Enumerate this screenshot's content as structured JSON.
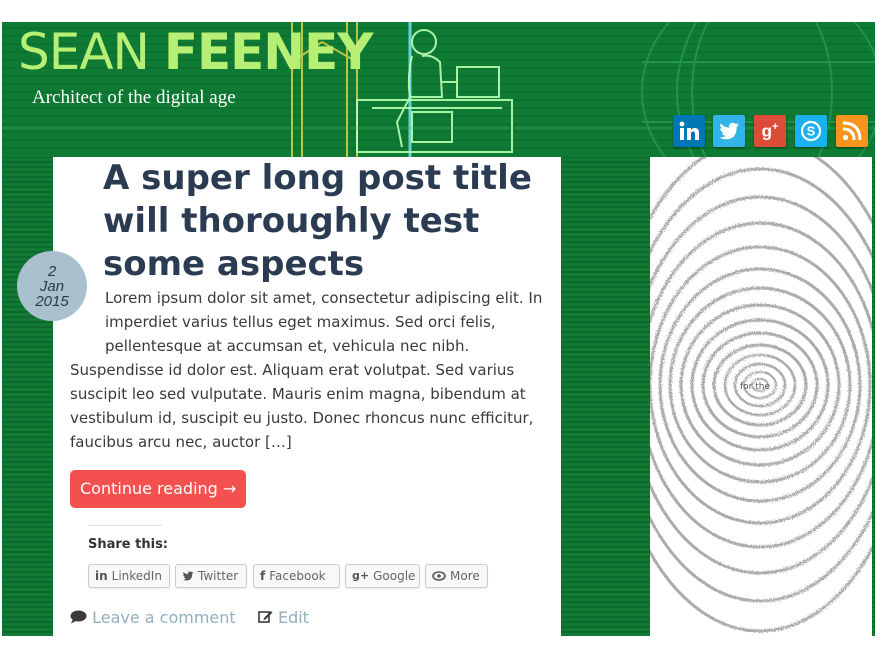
{
  "site": {
    "title_first": "SEAN",
    "title_last": "FEENEY",
    "tagline": "Architect of the digital age"
  },
  "social": [
    {
      "name": "LinkedIn",
      "icon": "linkedin-icon",
      "color": "#0077b5"
    },
    {
      "name": "Twitter",
      "icon": "twitter-icon",
      "color": "#32b4e8"
    },
    {
      "name": "Google+",
      "icon": "google-plus-icon",
      "color": "#dd4b39"
    },
    {
      "name": "Skype",
      "icon": "skype-icon",
      "color": "#19b2ee"
    },
    {
      "name": "RSS",
      "icon": "rss-icon",
      "color": "#f7941d"
    }
  ],
  "post": {
    "title": "A super long post title will thoroughly test some aspects",
    "date": {
      "day": "2",
      "month": "Jan",
      "year": "2015"
    },
    "excerpt": "Lorem ipsum dolor sit amet, consectetur adipiscing elit. In imperdiet varius tellus eget maximus. Sed orci felis, pellentesque at accumsan et, vehicula nec nibh. Suspendisse id dolor est. Aliquam erat volutpat. Sed varius suscipit leo sed vulputate. Mauris enim magna, bibendum at vestibulum id, suscipit eu justo. Donec rhoncus nunc efficitur, faucibus arcu nec, auctor […]",
    "continue_label": "Continue reading →",
    "share_heading": "Share this:",
    "share_buttons": [
      {
        "label": "LinkedIn",
        "icon": "linkedin-icon"
      },
      {
        "label": "Twitter",
        "icon": "twitter-icon"
      },
      {
        "label": "Facebook",
        "icon": "facebook-icon"
      },
      {
        "label": "Google",
        "icon": "google-plus-icon"
      },
      {
        "label": "More",
        "icon": "more-icon"
      }
    ],
    "comment_label": "Leave a comment",
    "edit_label": "Edit"
  },
  "sidebar": {
    "image_text": "for the"
  },
  "colors": {
    "header_green": "#0f7a33",
    "title_green": "#b7ef74",
    "post_title": "#2b3c52",
    "button_red": "#f3504f",
    "date_badge": "#a9c0ce",
    "link_blue": "#93aebd"
  }
}
